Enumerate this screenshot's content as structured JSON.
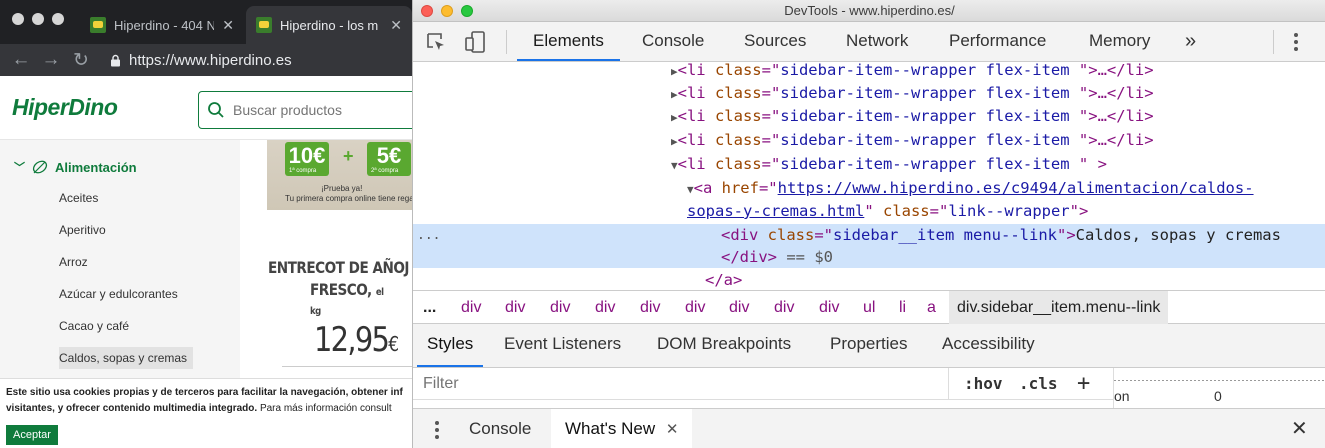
{
  "browser": {
    "tabs": [
      {
        "title": "Hiperdino - 404 N",
        "active": false
      },
      {
        "title": "Hiperdino - los m",
        "active": true
      }
    ],
    "url": "https://www.hiperdino.es",
    "icons": {
      "back": "arrow-left-icon",
      "forward": "arrow-right-icon",
      "reload": "reload-icon",
      "lock": "lock-icon"
    }
  },
  "site": {
    "logo": "HiperDino",
    "search_placeholder": "Buscar productos",
    "sidebar": {
      "category": "Alimentación",
      "items": [
        "Aceites",
        "Aperitivo",
        "Arroz",
        "Azúcar y edulcorantes",
        "Cacao y café",
        "Caldos, sopas y cremas"
      ],
      "selected_index": 5
    },
    "promo": {
      "box1": "10€",
      "box1_sub": "1ª compra",
      "plus": "+",
      "box2": "5€",
      "box2_sub": "2ª compra",
      "line1": "¡Prueba ya!",
      "line2": "Tu primera compra online tiene rega"
    },
    "product": {
      "name_line1": "ENTRECOT DE AÑOJ",
      "name_line2": "FRESCO,",
      "unit": "el kg",
      "price": "12,95",
      "currency": "€"
    },
    "cookie": {
      "line1": "Este sitio usa cookies propias y de terceros para facilitar la navegación, obtener inf",
      "line2_bold": "visitantes, y ofrecer contenido multimedia integrado.",
      "line2_rest": " Para más información consult",
      "accept": "Aceptar"
    }
  },
  "devtools": {
    "window_title": "DevTools - www.hiperdino.es/",
    "tabs": [
      "Elements",
      "Console",
      "Sources",
      "Network",
      "Performance",
      "Memory"
    ],
    "active_tab": "Elements",
    "more": "»",
    "dom": {
      "li_tag_open": "<li ",
      "li_attr": "class",
      "li_eq": "=\"",
      "li_val": "sidebar-item--wrapper flex-item ",
      "li_close_collapsed": "\">…</li>",
      "li_close_open": "\" >",
      "a_open": "<a ",
      "a_href_attr": "href",
      "a_href": "https://www.hiperdino.es/c9494/alimentacion/caldos-",
      "a_href2": "sopas-y-cremas.html",
      "a_class_attr": "class",
      "a_class_val": "link--wrapper",
      "div_open": "<div ",
      "div_class_attr": "class",
      "div_class_val": "sidebar__item menu--link",
      "div_text": "Caldos, sopas y cremas",
      "div_close": "</div>",
      "eq_dollar": " == $0",
      "a_close": "</a>",
      "ellipsis": "..."
    },
    "breadcrumbs": [
      "...",
      "div",
      "div",
      "div",
      "div",
      "div",
      "div",
      "div",
      "div",
      "div",
      "ul",
      "li",
      "a",
      "div.sidebar__item.menu--link"
    ],
    "subtabs": [
      "Styles",
      "Event Listeners",
      "DOM Breakpoints",
      "Properties",
      "Accessibility"
    ],
    "active_subtab": "Styles",
    "filter_placeholder": "Filter",
    "hov": ":hov",
    "cls": ".cls",
    "plus": "+",
    "computed_label": "on",
    "computed_value": "0",
    "drawer_tabs": [
      "Console",
      "What's New"
    ],
    "active_drawer_tab": "What's New"
  }
}
